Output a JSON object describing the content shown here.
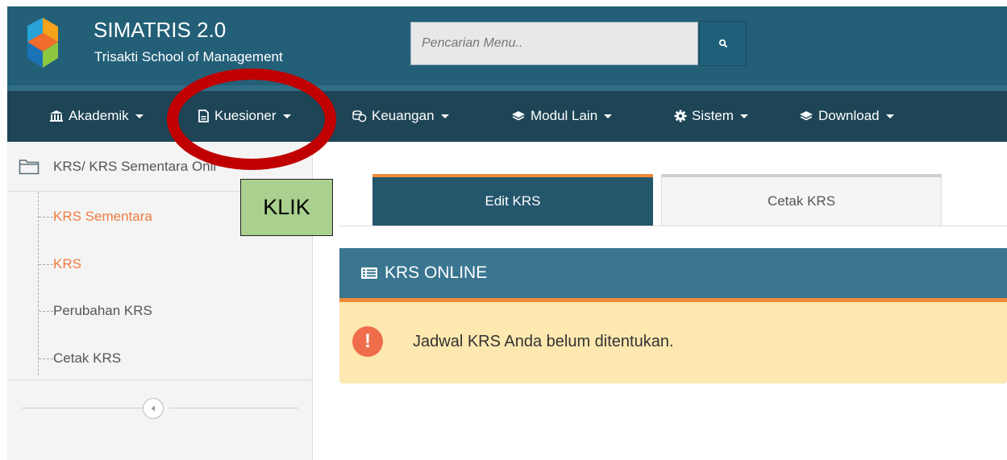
{
  "app": {
    "title": "SIMATRIS 2.0",
    "subtitle": "Trisakti School of Management",
    "brand_color": "#236078",
    "accent_color": "#f08a3a"
  },
  "search": {
    "placeholder": "Pencarian Menu..",
    "button_icon": "search-icon"
  },
  "nav": [
    {
      "label": "Akademik",
      "icon": "bank-icon"
    },
    {
      "label": "Kuesioner",
      "icon": "document-icon"
    },
    {
      "label": "Keuangan",
      "icon": "coins-icon"
    },
    {
      "label": "Modul Lain",
      "icon": "layers-icon"
    },
    {
      "label": "Sistem",
      "icon": "gear-icon"
    },
    {
      "label": "Download",
      "icon": "layers-icon"
    }
  ],
  "sidebar": {
    "header": "KRS/ KRS Sementara Onli",
    "items": [
      {
        "label": "KRS Sementara",
        "active": true
      },
      {
        "label": "KRS",
        "active": true
      },
      {
        "label": "Perubahan KRS",
        "active": false
      },
      {
        "label": "Cetak KRS",
        "active": false
      }
    ]
  },
  "tabs": [
    {
      "label": "Edit KRS",
      "active": true
    },
    {
      "label": "Cetak KRS",
      "active": false
    }
  ],
  "panel": {
    "title": "KRS ONLINE",
    "alert_icon": "!",
    "alert_text": "Jadwal KRS Anda belum ditentukan."
  },
  "annotation": {
    "label": "KLIK",
    "ring_color": "#c00000",
    "box_color": "#a9d08e"
  }
}
